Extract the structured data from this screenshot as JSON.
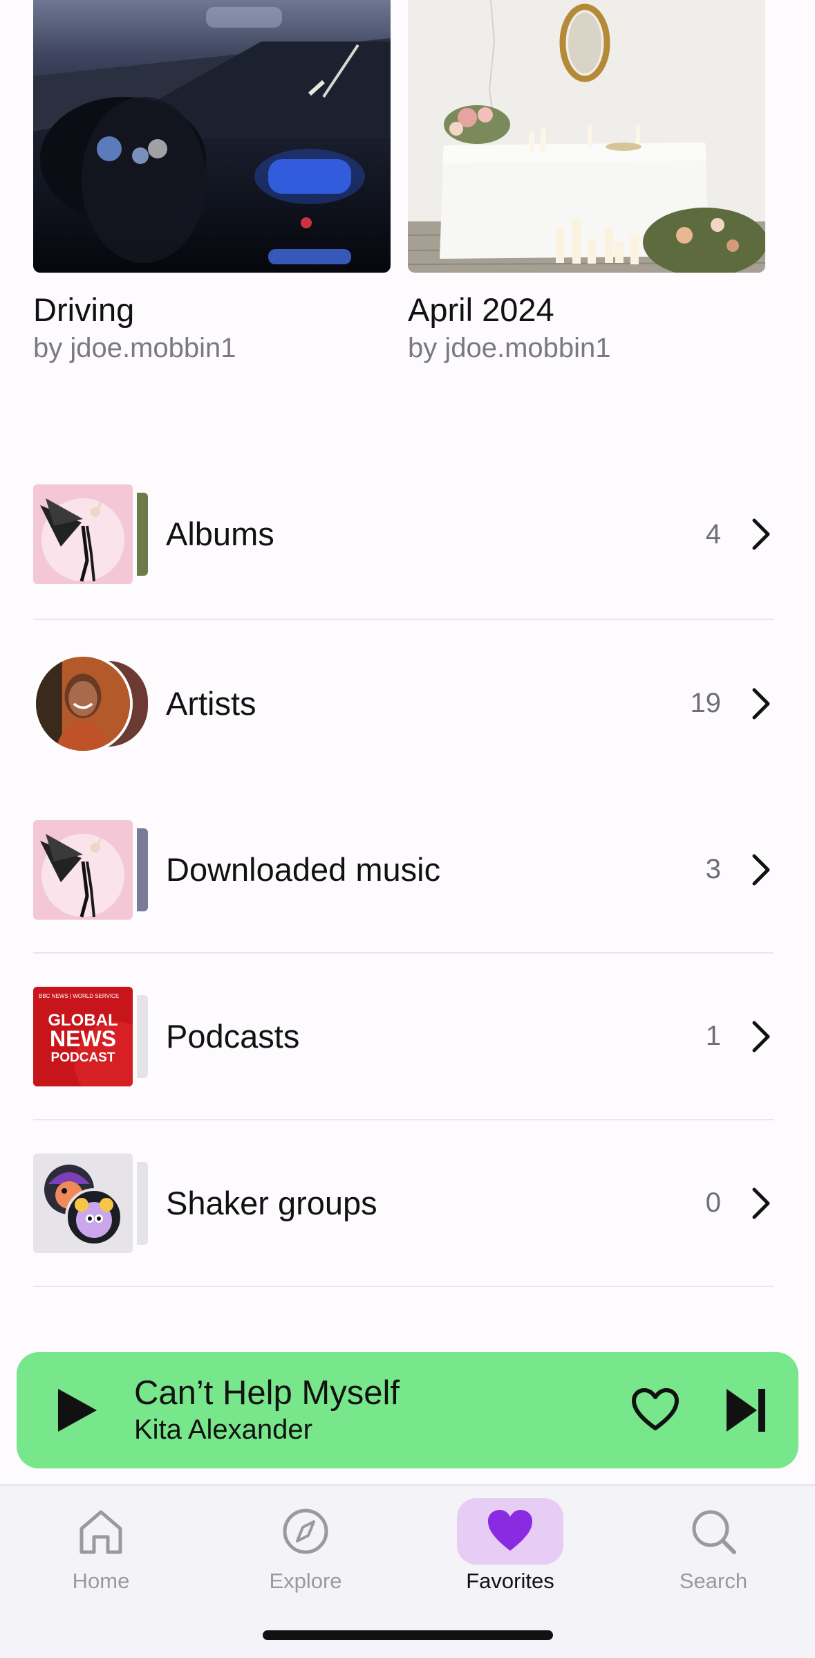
{
  "playlists": [
    {
      "title": "Driving",
      "byline": "by jdoe.mobbin1"
    },
    {
      "title": "April 2024",
      "byline": "by jdoe.mobbin1"
    }
  ],
  "library": [
    {
      "label": "Albums",
      "count": "4"
    },
    {
      "label": "Artists",
      "count": "19"
    },
    {
      "label": "Downloaded music",
      "count": "3"
    },
    {
      "label": "Podcasts",
      "count": "1"
    },
    {
      "label": "Shaker groups",
      "count": "0"
    }
  ],
  "podcast_art": {
    "line1": "BBC NEWS | WORLD SERVICE",
    "line2": "GLOBAL",
    "line3": "NEWS",
    "line4": "PODCAST"
  },
  "player": {
    "title": "Can’t Help Myself",
    "artist": "Kita Alexander",
    "color": "#78e68a"
  },
  "tabs": [
    {
      "label": "Home",
      "icon": "home-icon"
    },
    {
      "label": "Explore",
      "icon": "compass-icon"
    },
    {
      "label": "Favorites",
      "icon": "heart-icon",
      "active": true
    },
    {
      "label": "Search",
      "icon": "search-icon"
    }
  ],
  "colors": {
    "accent": "#8a2be2",
    "active_tab_bg": "#e7ccf6"
  }
}
